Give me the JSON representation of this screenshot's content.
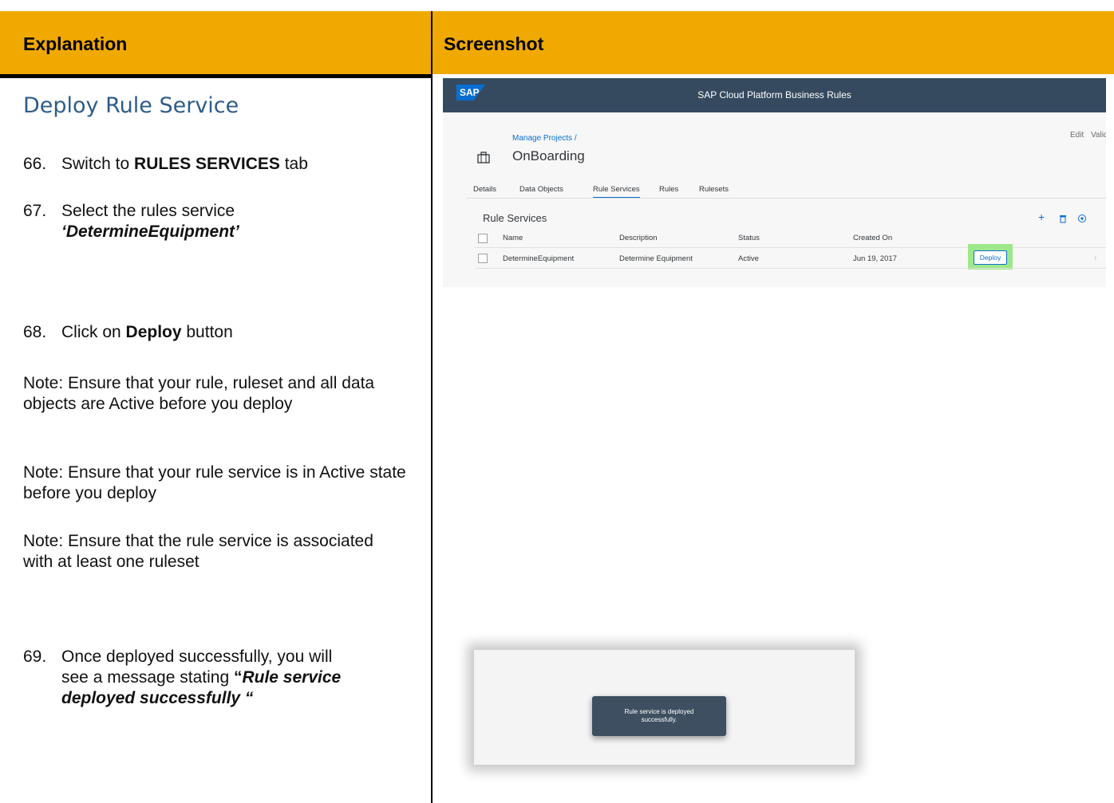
{
  "header": {
    "explanation": "Explanation",
    "screenshot": "Screenshot"
  },
  "section_title": "Deploy Rule Service",
  "steps": [
    {
      "num": "66.",
      "pre": "Switch to ",
      "bold": "RULES SERVICES",
      "post": " tab"
    },
    {
      "num": "67.",
      "pre": "Select the rules service",
      "bolditalic": "‘DetermineEquipment’"
    },
    {
      "num": "68.",
      "pre": "Click on ",
      "bold": "Deploy",
      "post": " button"
    },
    {
      "num": "69.",
      "pre1": "Once deployed successfully, you will",
      "pre2": "see a message stating ",
      "quote": "“",
      "bolditalic1": "Rule service",
      "bolditalic2": "deployed successfully “"
    }
  ],
  "notes": [
    "Note: Ensure that your rule, ruleset and all data objects are Active before you deploy",
    "Note: Ensure that your rule service is in Active state before you deploy",
    "Note: Ensure that the rule service is associated with at least one ruleset"
  ],
  "sap": {
    "logo": "SAP",
    "app_title": "SAP Cloud Platform Business Rules",
    "breadcrumb": "Manage Projects /",
    "project": "OnBoarding",
    "actions": [
      "Edit",
      "Valida"
    ],
    "tabs": [
      "Details",
      "Data Objects",
      "Rule Services",
      "Rules",
      "Rulesets"
    ],
    "active_tab": "Rule Services",
    "table_title": "Rule Services",
    "columns": [
      "Name",
      "Description",
      "Status",
      "Created On"
    ],
    "rows": [
      {
        "name": "DetermineEquipment",
        "description": "Determine Equipment",
        "status": "Active",
        "created": "Jun 19, 2017",
        "action": "Deploy"
      }
    ]
  },
  "toast": {
    "message": "Rule service is deployed successfully."
  }
}
